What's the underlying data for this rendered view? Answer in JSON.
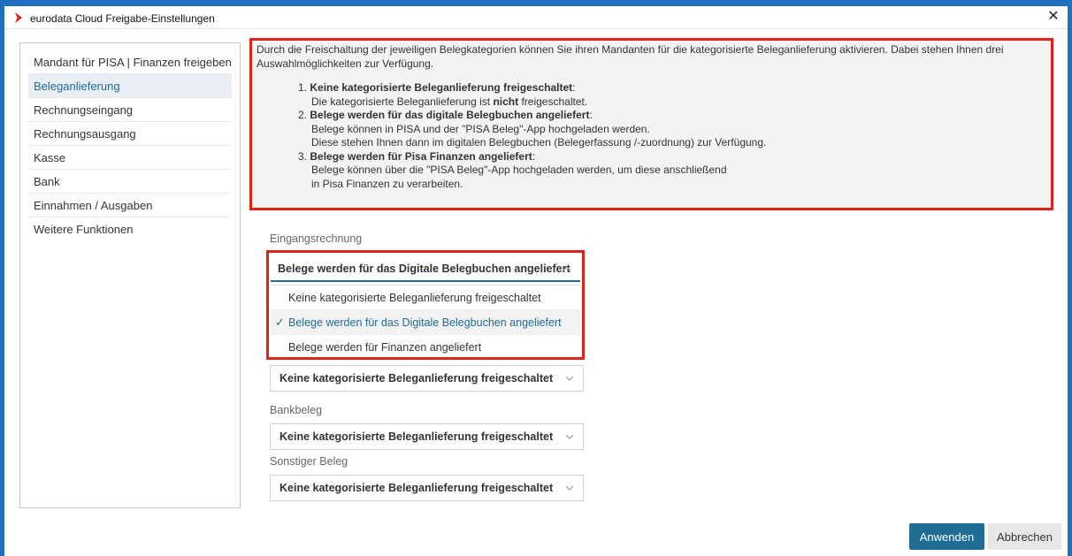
{
  "window": {
    "title": "eurodata Cloud Freigabe-Einstellungen",
    "close_icon": "close-icon",
    "logo_icon": "chevron-right-icon",
    "accent_color": "#1f6d95",
    "highlight_color": "#e0221b"
  },
  "sidebar": {
    "items": [
      {
        "label": "Mandant für PISA | Finanzen freigeben",
        "active": false
      },
      {
        "label": "Beleganlieferung",
        "active": true
      },
      {
        "label": "Rechnungseingang",
        "active": false
      },
      {
        "label": "Rechnungsausgang",
        "active": false
      },
      {
        "label": "Kasse",
        "active": false
      },
      {
        "label": "Bank",
        "active": false
      },
      {
        "label": "Einnahmen / Ausgaben",
        "active": false
      },
      {
        "label": "Weitere Funktionen",
        "active": false
      }
    ]
  },
  "info": {
    "intro": "Durch die Freischaltung der jeweiligen Belegkategorien können Sie ihren Mandanten für die kategorisierte Beleganlieferung aktivieren. Dabei stehen Ihnen drei Auswahlmöglichkeiten zur Verfügung.",
    "items": [
      {
        "num": "1.",
        "title": "Keine kategorisierte Beleganlieferung freigeschaltet",
        "line1_pre": "Die kategorisierte Beleganlieferung ist ",
        "line1_bold": "nicht",
        "line1_post": " freigeschaltet.",
        "line2": ""
      },
      {
        "num": "2.",
        "title": "Belege werden für das digitale Belegbuchen angeliefert",
        "line1_pre": "Belege können in PISA und der \"PISA Beleg\"-App hochgeladen werden.",
        "line1_bold": "",
        "line1_post": "",
        "line2": "Diese stehen Ihnen dann im digitalen Belegbuchen (Belegerfassung /-zuordnung) zur Verfügung."
      },
      {
        "num": "3.",
        "title": "Belege werden für Pisa Finanzen angeliefert",
        "line1_pre": "Belege können über die \"PISA Beleg\"-App hochgeladen werden, um diese anschließend",
        "line1_bold": "",
        "line1_post": "",
        "line2": "in Pisa Finanzen zu verarbeiten."
      }
    ]
  },
  "form": {
    "eingangsrechnung_label": "Eingangsrechnung",
    "eingang_select_value": "Belege werden für das Digitale Belegbuchen angeliefert",
    "eingang_options": [
      {
        "label": "Keine kategorisierte Beleganlieferung freigeschaltet",
        "selected": false
      },
      {
        "label": "Belege werden für das Digitale Belegbuchen angeliefert",
        "selected": true
      },
      {
        "label": "Belege werden für Finanzen angeliefert",
        "selected": false
      }
    ],
    "second_select_value": "Keine kategorisierte Beleganlieferung freigeschaltet",
    "bankbeleg_label": "Bankbeleg",
    "bankbeleg_select_value": "Keine kategorisierte Beleganlieferung freigeschaltet",
    "sonstiger_label": "Sonstiger Beleg",
    "sonstiger_select_value": "Keine kategorisierte Beleganlieferung freigeschaltet",
    "check_mark": "✓"
  },
  "footer": {
    "apply_label": "Anwenden",
    "cancel_label": "Abbrechen"
  }
}
